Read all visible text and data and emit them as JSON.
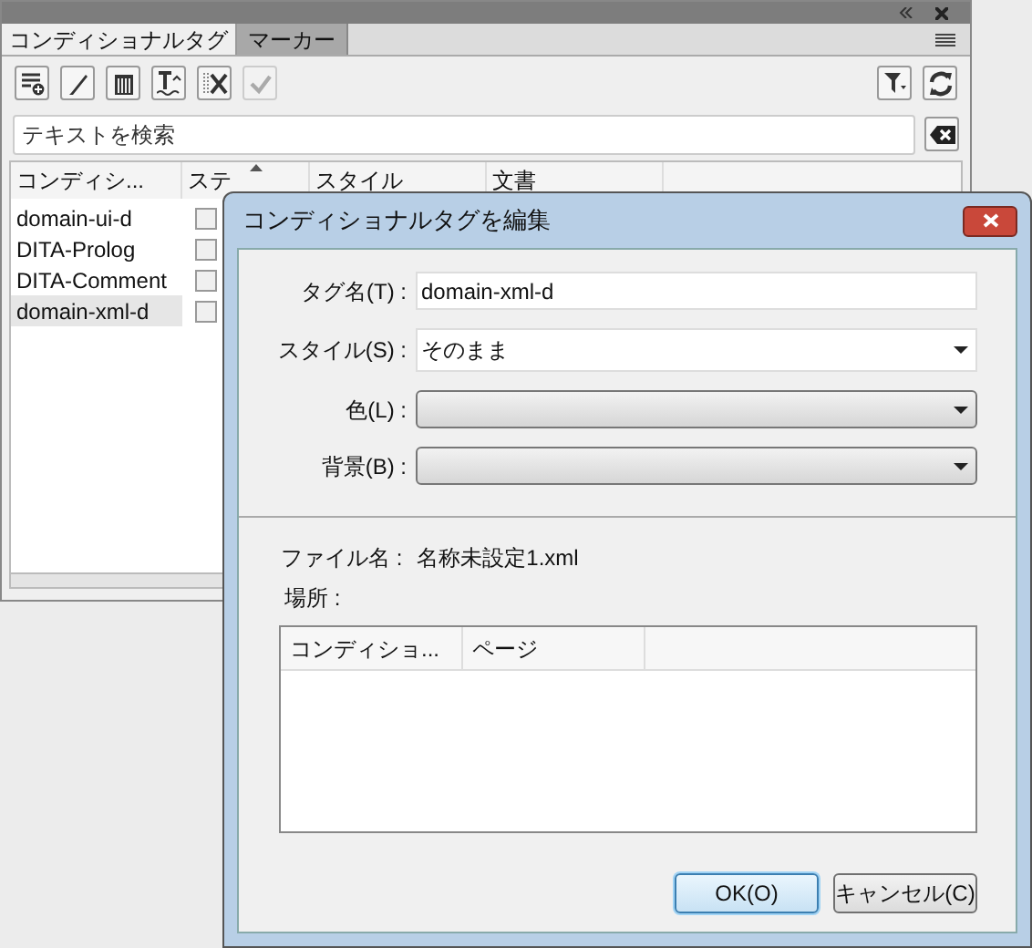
{
  "panel": {
    "tabs": [
      {
        "label": "コンディショナルタグ",
        "selected": true
      },
      {
        "label": "マーカー",
        "selected": false
      }
    ],
    "toolbar": [
      {
        "kind": "new",
        "disabled": false
      },
      {
        "kind": "edit",
        "disabled": false
      },
      {
        "kind": "delete",
        "disabled": false
      },
      {
        "kind": "format",
        "disabled": false
      },
      {
        "kind": "remove",
        "disabled": false
      },
      {
        "kind": "apply",
        "disabled": true
      }
    ],
    "search": {
      "placeholder": "テキストを検索"
    },
    "table": {
      "columns": [
        "コンディシ...",
        "ステ",
        "スタイル",
        "文書"
      ],
      "rows": [
        {
          "name": "domain-ui-d",
          "checked": false,
          "selected": false
        },
        {
          "name": "DITA-Prolog",
          "checked": false,
          "selected": false
        },
        {
          "name": "DITA-Comment",
          "checked": false,
          "selected": false
        },
        {
          "name": "domain-xml-d",
          "checked": false,
          "selected": true
        }
      ]
    }
  },
  "dialog": {
    "title": "コンディショナルタグを編集",
    "fields": [
      {
        "kind": "text",
        "label": "タグ名(T) :",
        "value": "domain-xml-d"
      },
      {
        "kind": "dropdown",
        "label": "スタイル(S) :",
        "value": "そのまま"
      },
      {
        "kind": "dropdown-empty",
        "label": "色(L) :"
      },
      {
        "kind": "dropdown-empty",
        "label": "背景(B) :"
      }
    ],
    "file_name": {
      "label": "ファイル名 :",
      "value": "名称未設定1.xml"
    },
    "location": {
      "label": "場所 :",
      "columns": [
        "コンディショ...",
        "ページ"
      ]
    },
    "buttons": [
      {
        "label": "OK(O)",
        "default": true
      },
      {
        "label": "キャンセル(C)",
        "default": false
      }
    ]
  }
}
